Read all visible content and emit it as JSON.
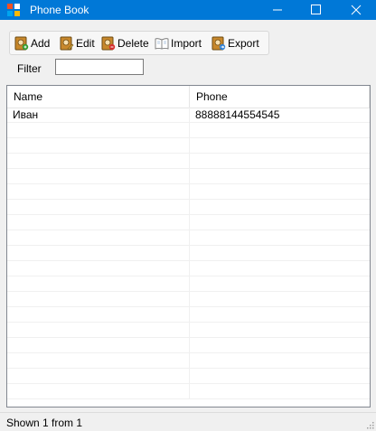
{
  "window": {
    "title": "Phone Book"
  },
  "toolbar": {
    "buttons": [
      {
        "label": "Add",
        "icon": "contact-add-icon"
      },
      {
        "label": "Edit",
        "icon": "contact-edit-icon"
      },
      {
        "label": "Delete",
        "icon": "contact-delete-icon"
      },
      {
        "label": "Import",
        "icon": "book-open-icon"
      },
      {
        "label": "Export",
        "icon": "contact-export-icon"
      }
    ]
  },
  "filter": {
    "label": "Filter",
    "value": ""
  },
  "table": {
    "columns": [
      "Name",
      "Phone"
    ],
    "rows": [
      {
        "name": "Иван",
        "phone": "88888144554545"
      }
    ]
  },
  "status": {
    "text": "Shown 1 from 1"
  },
  "colors": {
    "titlebar": "#0078d7",
    "background": "#f0f0f0",
    "grid_border": "#828790"
  }
}
